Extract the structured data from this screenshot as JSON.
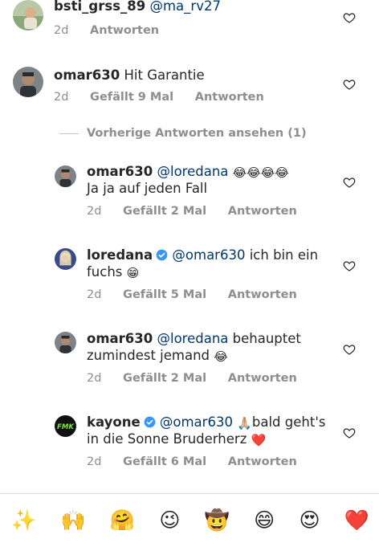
{
  "comments": [
    {
      "username": "bsti_grss_89",
      "mention": "@ma_rv27",
      "body": "",
      "age": "2d",
      "likes": "",
      "reply_label": "Antworten",
      "verified": false
    },
    {
      "username": "omar630",
      "mention": "",
      "body": "Hit Garantie",
      "age": "2d",
      "likes": "Gefällt 9 Mal",
      "reply_label": "Antworten",
      "verified": false
    }
  ],
  "view_replies_label": "Vorherige Antworten ansehen (1)",
  "replies": [
    {
      "username": "omar630",
      "mention": "@loredana",
      "body_line1_emoji": "😂😂😂😂",
      "body_line2": "Ja ja auf jeden Fall",
      "age": "2d",
      "likes": "Gefällt 2 Mal",
      "reply_label": "Antworten"
    },
    {
      "username": "loredana",
      "verified": true,
      "mention": "@omar630",
      "body_line1": "ich bin ein",
      "body_line2": "fuchs",
      "body_line2_emoji": "😁",
      "age": "2d",
      "likes": "Gefällt 5 Mal",
      "reply_label": "Antworten"
    },
    {
      "username": "omar630",
      "mention": "@loredana",
      "body_line1": "behauptet",
      "body_line2": "zumindest jemand",
      "body_line2_emoji": "😂",
      "age": "2d",
      "likes": "Gefällt 2 Mal",
      "reply_label": "Antworten"
    },
    {
      "username": "kayone",
      "verified": true,
      "mention": "@omar630",
      "body_line1_emoji": "🙏🏼",
      "body_line1": "bald geht's",
      "body_line2": "in die Sonne Bruderherz",
      "body_line2_emoji": "❤️",
      "age": "2d",
      "likes": "Gefällt 6 Mal",
      "reply_label": "Antworten"
    }
  ],
  "emoji_bar": [
    "✨",
    "🙌",
    "🤗",
    "😉",
    "🤠",
    "😄",
    "😍",
    "❤️"
  ],
  "icons": {
    "like": "heart-outline-icon",
    "verified": "verified-badge-icon"
  },
  "colors": {
    "text": "#262626",
    "mention": "#00376b",
    "meta": "#8e8e8e",
    "verified": "#3897f0"
  }
}
